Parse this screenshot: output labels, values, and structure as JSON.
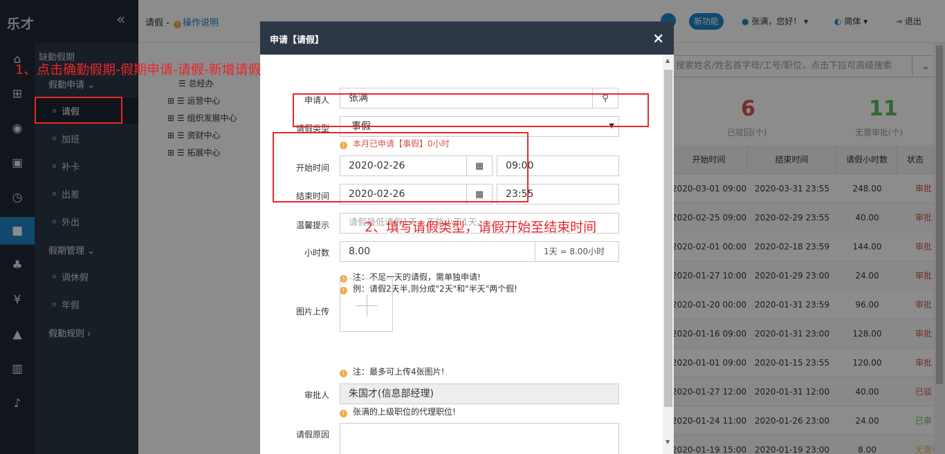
{
  "app": {
    "logo": "乐才",
    "collapse": "«"
  },
  "rail_icons": [
    "home-icon",
    "org-chart-icon",
    "user-circle-icon",
    "calendar-check-icon",
    "clock-icon",
    "briefcase-icon",
    "gift-icon",
    "yen-icon",
    "graduation-cap-icon",
    "bar-chart-icon",
    "bell-icon"
  ],
  "menu": {
    "title": "缺勤假期",
    "group_leave_apply": "假勤申请",
    "items_apply": [
      "请假",
      "加班",
      "补卡",
      "出差",
      "外出"
    ],
    "group_leave_manage": "假期管理",
    "items_manage": [
      "调休假",
      "年假"
    ],
    "group_rules": "假勤规则"
  },
  "header": {
    "crumb": "请假 - ",
    "help": "操作说明",
    "new_feature": "新功能",
    "user": "张满，您好！",
    "lang": "简体",
    "logout": "退出"
  },
  "tree": {
    "root": "总经办",
    "nodes": [
      "运营中心",
      "组织发展中心",
      "资财中心",
      "拓展中心"
    ]
  },
  "search": {
    "placeholder": "搜索姓名/姓名首字母/工号/职位，点击下拉可高级搜索"
  },
  "stats": [
    {
      "value": "6",
      "label": "已驳回(个)",
      "color": "#d9534f"
    },
    {
      "value": "11",
      "label": "无需审批(个)",
      "color": "#5cb85c"
    }
  ],
  "table": {
    "headers": [
      "开始时间",
      "结束时间",
      "请假小时数",
      "状态"
    ],
    "rows": [
      [
        "2020-03-01 09:00",
        "2020-03-31 23:55",
        "248.00",
        "审批"
      ],
      [
        "2020-02-25 09:00",
        "2020-02-29 23:55",
        "40.00",
        "审批"
      ],
      [
        "2020-02-01 00:00",
        "2020-02-18 23:59",
        "144.00",
        "审批"
      ],
      [
        "2020-01-27 10:00",
        "2020-01-29 23:00",
        "24.00",
        "审批"
      ],
      [
        "2020-01-20 00:00",
        "2020-01-31 23:59",
        "96.00",
        "审批"
      ],
      [
        "2020-01-16 09:00",
        "2020-01-31 23:00",
        "128.00",
        "审批"
      ],
      [
        "2020-01-01 09:00",
        "2020-01-15 23:55",
        "120.00",
        "审批"
      ],
      [
        "2020-01-27 12:00",
        "2020-01-31 12:00",
        "40.00",
        "已驳"
      ],
      [
        "2020-01-24 11:00",
        "2020-01-26 23:00",
        "24.00",
        "已审"
      ],
      [
        "2020-01-19 15:00",
        "2020-01-19 23:00",
        "8.00",
        "无需审"
      ]
    ]
  },
  "dialog": {
    "title": "申请【请假】",
    "close": "×",
    "applicant_label": "申请人",
    "applicant": "张满",
    "type_label": "请假类型",
    "type_value": "事假",
    "type_hint": "本月已申请【事假】0小时",
    "start_label": "开始时间",
    "start_date": "2020-02-26",
    "start_time": "09:00",
    "end_label": "结束时间",
    "end_date": "2020-02-26",
    "end_time": "23:55",
    "tip_label": "温馨提示",
    "tip_placeholder": "请假最低请假1天，不能小于1天。",
    "hours_label": "小时数",
    "hours": "8.00",
    "days": "1天 = 8.00小时",
    "note1": "注：不足一天的请假，需单独申请!",
    "note2": "例：请假2天半,则分成\"2天\"和\"半天\"两个假!",
    "image_label": "图片上传",
    "image_note": "注：最多可上传4张图片!",
    "approver_label": "审批人",
    "approver": "朱国才(信息部经理)",
    "approver_hint": "张满的上级职位的代理职位!",
    "reason_label": "请假原因"
  },
  "annotations": {
    "step1": "1、点击确勤假期-假期申请-请假-新增请假",
    "step2": "2、填写请假类型，请假开始至结束时间"
  }
}
